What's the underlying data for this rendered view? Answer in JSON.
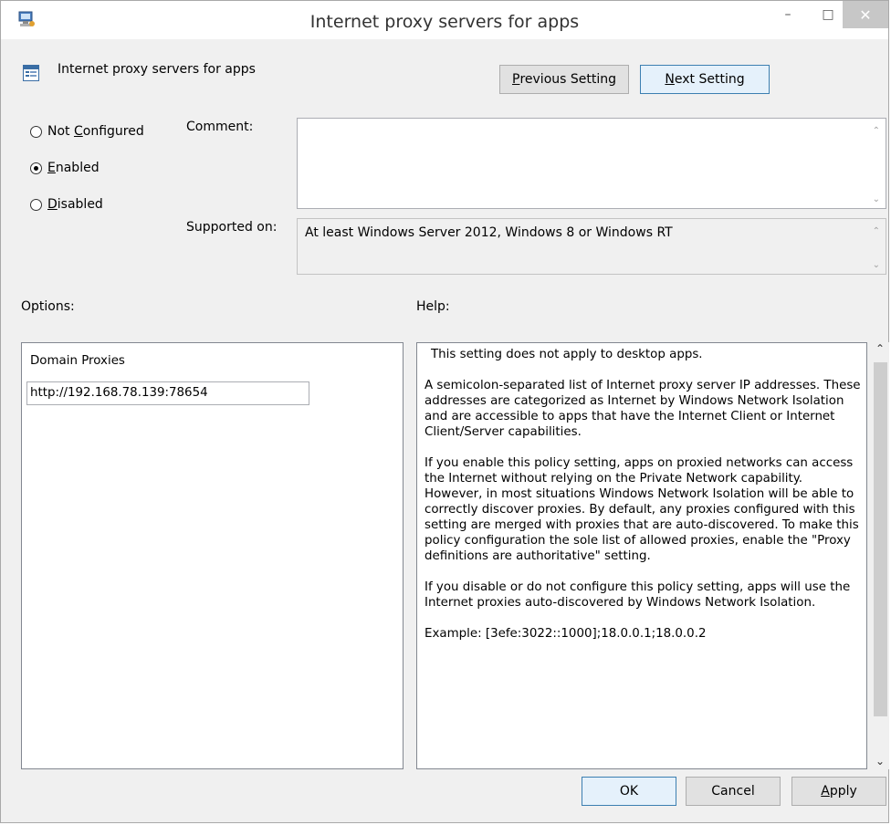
{
  "window": {
    "title": "Internet proxy servers for apps",
    "minimize_glyph": "–",
    "maximize_glyph": "□",
    "close_glyph": "✕"
  },
  "header": {
    "setting_name": "Internet proxy servers for apps",
    "previous_button": {
      "mnemonic": "P",
      "rest": "revious Setting"
    },
    "next_button": {
      "mnemonic": "N",
      "rest": "ext Setting"
    }
  },
  "state": {
    "not_configured": {
      "pre": "Not ",
      "mnemonic": "C",
      "post": "onfigured"
    },
    "enabled": {
      "pre": "",
      "mnemonic": "E",
      "post": "nabled"
    },
    "disabled": {
      "pre": "",
      "mnemonic": "D",
      "post": "isabled"
    },
    "selected": "enabled"
  },
  "comment": {
    "label": "Comment:",
    "value": ""
  },
  "supported_on": {
    "label": "Supported on:",
    "value": "At least Windows Server 2012, Windows 8 or Windows RT"
  },
  "options": {
    "label": "Options:",
    "domain_proxies_label": "Domain Proxies",
    "domain_proxies_value": "http://192.168.78.139:78654"
  },
  "help": {
    "label": "Help:",
    "paragraphs": [
      "This setting does not apply to desktop apps.",
      "A semicolon-separated list of Internet proxy server IP addresses. These addresses are categorized as Internet by Windows Network Isolation and are accessible to  apps that have the Internet Client or Internet Client/Server capabilities.",
      "If you enable this policy setting, apps on proxied networks can access the Internet without relying on the Private Network capability. However, in most situations Windows Network Isolation will be able to correctly discover proxies. By default, any proxies configured with this setting are merged with proxies that are auto-discovered. To make this policy configuration the sole list of allowed proxies, enable the \"Proxy definitions are authoritative\" setting.",
      "If you disable or do not configure this policy setting, apps will use the Internet proxies auto-discovered by Windows Network Isolation.",
      "Example: [3efe:3022::1000];18.0.0.1;18.0.0.2"
    ]
  },
  "footer": {
    "ok": "OK",
    "cancel": "Cancel",
    "apply": {
      "mnemonic": "A",
      "rest": "pply"
    }
  }
}
